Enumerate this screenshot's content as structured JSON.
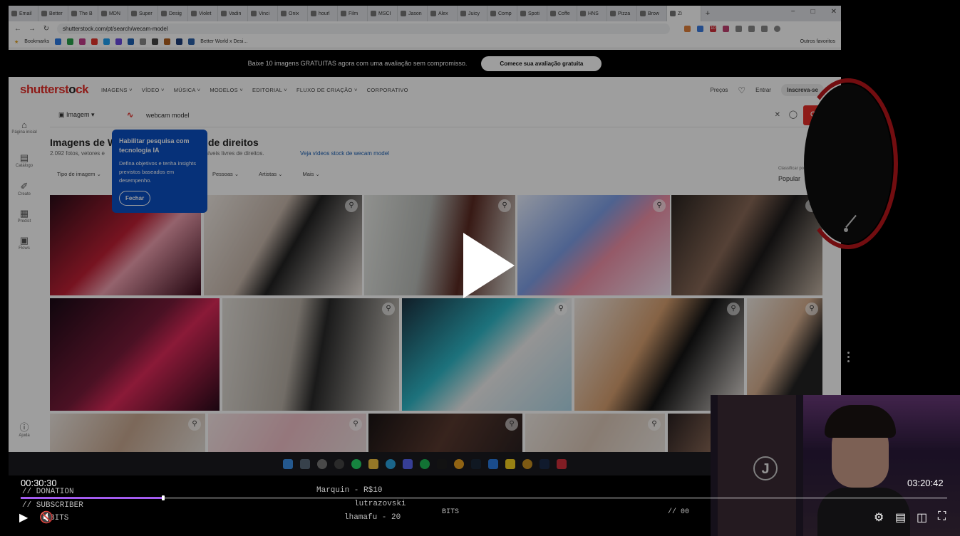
{
  "browser": {
    "tabs": [
      "Email",
      "Better",
      "The B",
      "MDN",
      "Super",
      "Desig",
      "Violet",
      "Vadin",
      "Vinci",
      "Onix",
      "hourl",
      "Film",
      "MSCI",
      "Jason",
      "Alex",
      "Juicy",
      "Comp",
      "Spoti",
      "Coffe",
      "HNS",
      "Pizza",
      "Brow",
      "Zi"
    ],
    "url": "shutterstock.com/pt/search/wecam-model",
    "bookmarks_label": "Bookmarks",
    "bookmark_item": "Better World x Desi...",
    "other_bookmarks": "Outros favoritos",
    "ext_badge": "10"
  },
  "promo": {
    "text": "Baixe 10 imagens GRATUITAS agora com uma avaliação sem compromisso.",
    "button": "Comece sua avaliação gratuita"
  },
  "header": {
    "logo_a": "shutterst",
    "logo_b": "ck",
    "nav": [
      "IMAGENS",
      "VÍDEO",
      "MÚSICA",
      "MODELOS",
      "EDITORIAL",
      "FLUXO DE CRIAÇÃO",
      "CORPORATIVO"
    ],
    "precos": "Preços",
    "entrar": "Entrar",
    "inscreva": "Inscreva-se"
  },
  "sidebar": [
    "Página inicial",
    "Catálogo",
    "Create",
    "Predict",
    "Flows"
  ],
  "sidebar_help": "Ajuda",
  "search": {
    "type": "Imagem",
    "query": "webcam model"
  },
  "results": {
    "title_a": "Imagens de W",
    "title_b": "de direitos",
    "subtitle": "2.092 fotos, vetores e",
    "subtitle2": "tações disponíveis livres de direitos.",
    "link": "Veja vídeos stock de wecam model",
    "filters": [
      "Tipo de imagem"
    ],
    "filters2": [
      "Pessoas",
      "Artistas",
      "Mais"
    ],
    "sort_label": "Classificar por",
    "sort_value": "Popular"
  },
  "tooltip": {
    "title": "Habilitar pesquisa com tecnologia IA",
    "body": "Defina objetivos e tenha insights previstos baseados em desempenho.",
    "button": "Fechar"
  },
  "stream_overlay": {
    "donation_label": "// DONATION",
    "subscriber_label": "// SUBSCRIBER",
    "bits_label": "BITS",
    "donation": "Marquin - R$10",
    "subscriber": "lutrazovski",
    "bits": "lhamafu - 20",
    "bits_right": "BITS",
    "bits_right2": "// 00"
  },
  "player": {
    "current_time": "00:30:30",
    "duration": "03:20:42",
    "progress": 0.154
  },
  "colors": {
    "accent": "#e52d27",
    "progress": "#a35cf0",
    "tooltip": "#0a4fc4"
  }
}
